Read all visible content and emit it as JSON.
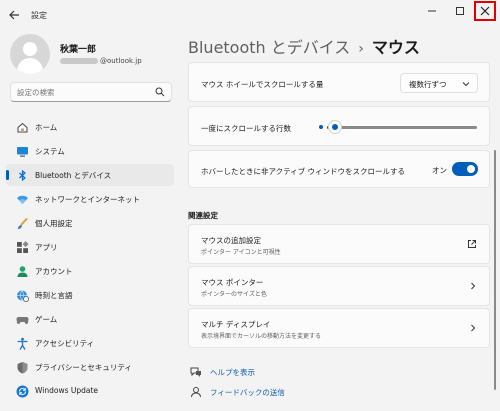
{
  "window": {
    "title": "設定",
    "back_icon": "arrow-left-icon",
    "minimize_icon": "minimize-icon",
    "maximize_icon": "maximize-icon",
    "close_icon": "close-icon"
  },
  "profile": {
    "name": "秋葉一郎",
    "email_visible": "@outlook.jp"
  },
  "search": {
    "placeholder": "設定の検索",
    "icon": "search-icon"
  },
  "sidebar": {
    "items": [
      {
        "label": "ホーム",
        "icon": "home-icon"
      },
      {
        "label": "システム",
        "icon": "display-icon"
      },
      {
        "label": "Bluetooth とデバイス",
        "icon": "bluetooth-icon",
        "active": true
      },
      {
        "label": "ネットワークとインターネット",
        "icon": "wifi-icon"
      },
      {
        "label": "個人用設定",
        "icon": "brush-icon"
      },
      {
        "label": "アプリ",
        "icon": "apps-icon"
      },
      {
        "label": "アカウント",
        "icon": "person-icon"
      },
      {
        "label": "時刻と言語",
        "icon": "globe-clock-icon"
      },
      {
        "label": "ゲーム",
        "icon": "gamepad-icon"
      },
      {
        "label": "アクセシビリティ",
        "icon": "accessibility-icon"
      },
      {
        "label": "プライバシーとセキュリティ",
        "icon": "shield-icon"
      },
      {
        "label": "Windows Update",
        "icon": "update-icon"
      }
    ]
  },
  "breadcrumb": {
    "parent": "Bluetooth とデバイス",
    "separator": "›",
    "current": "マウス"
  },
  "settings": {
    "wheel_scroll": {
      "label": "マウス ホイールでスクロールする量",
      "value": "複数行ずつ"
    },
    "lines_to_scroll": {
      "label": "一度にスクロールする行数",
      "level_fraction": 0.0
    },
    "inactive_scroll": {
      "label": "ホバーしたときに非アクティブ ウィンドウをスクロールする",
      "state_label": "オン",
      "on": true
    }
  },
  "related": {
    "title": "関連設定",
    "items": [
      {
        "label": "マウスの追加設定",
        "sub": "ポインター アイコンと可視性",
        "icon": "external-link-icon"
      },
      {
        "label": "マウス ポインター",
        "sub": "ポインターのサイズと色",
        "icon": "chevron-right-icon"
      },
      {
        "label": "マルチ ディスプレイ",
        "sub": "表示境界面でカーソルの移動方法を変更する",
        "icon": "chevron-right-icon"
      }
    ]
  },
  "help": {
    "help_label": "ヘルプを表示",
    "feedback_label": "フィードバックの送信"
  },
  "colors": {
    "accent": "#005fb8",
    "close_highlight": "#e00000"
  }
}
